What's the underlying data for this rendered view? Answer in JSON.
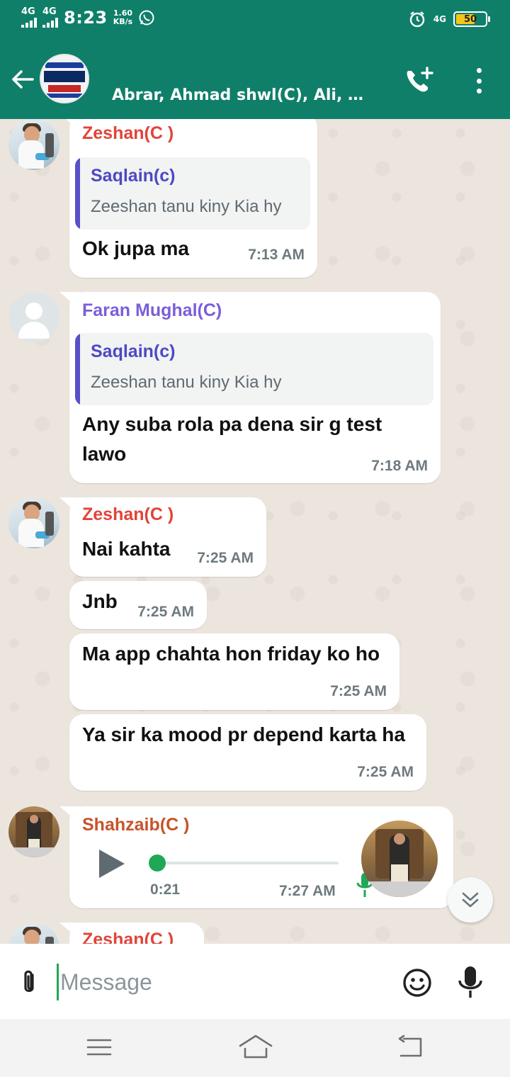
{
  "status_bar": {
    "net1": "4G",
    "net2": "4G",
    "time": "8:23",
    "speed_value": "1.60",
    "speed_unit": "KB/s",
    "right_net": "4G",
    "battery": "50"
  },
  "header": {
    "members": "Abrar, Ahmad  shwl(C), Ali, Ali..."
  },
  "messages": [
    {
      "sender": "Zeshan(C )",
      "sender_color": "#e0443a",
      "quote_name": "Saqlain(c)",
      "quote_text": "Zeeshan tanu kiny Kia hy",
      "text": "Ok jupa ma",
      "time": "7:13 AM"
    },
    {
      "sender": "Faran Mughal(C)",
      "sender_color": "#7b5ed9",
      "quote_name": "Saqlain(c)",
      "quote_text": "Zeeshan tanu kiny Kia hy",
      "text_line1": "Any suba rola pa dena sir g test",
      "text_line2": "lawo",
      "time": "7:18 AM"
    },
    {
      "sender": "Zeshan(C )",
      "sender_color": "#e0443a",
      "text": "Nai kahta",
      "time": "7:25 AM"
    },
    {
      "text": "Jnb",
      "time": "7:25 AM"
    },
    {
      "text": "Ma app chahta hon friday ko ho",
      "time": "7:25 AM"
    },
    {
      "text": "Ya sir ka mood pr depend karta ha",
      "time": "7:25 AM"
    },
    {
      "sender": "Shahzaib(C )",
      "sender_color": "#c8532b",
      "voice_duration": "0:21",
      "time": "7:27 AM"
    },
    {
      "sender": "Zeshan(C )",
      "sender_color": "#e0443a"
    }
  ],
  "composer": {
    "placeholder": "Message"
  },
  "colors": {
    "header": "#0f7f6a",
    "chat_bg": "#ece5dd",
    "accent_green": "#1fa855",
    "quote_bar": "#5b4fc9"
  },
  "icons": {
    "back": "arrow-left-icon",
    "add_call": "phone-add-icon",
    "menu": "more-vertical-icon",
    "attach": "paperclip-icon",
    "emoji": "smiley-icon",
    "mic": "mic-icon",
    "play": "play-icon",
    "scroll": "chevron-double-down-icon"
  }
}
